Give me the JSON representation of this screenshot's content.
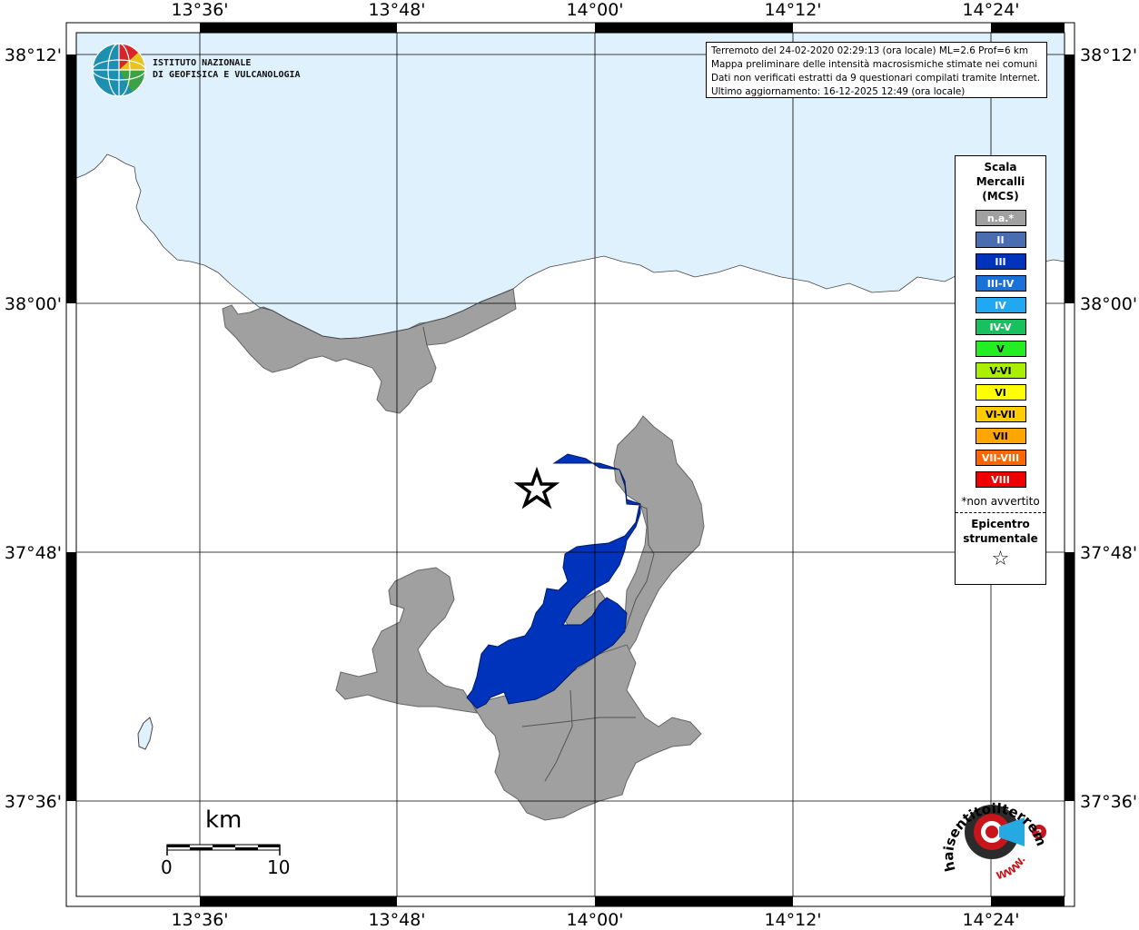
{
  "logo": {
    "name": "ingv-logo-icon",
    "line1": "ISTITUTO NAZIONALE",
    "line2": "DI GEOFISICA E VULCANOLOGIA"
  },
  "info": {
    "line1": "Terremoto del 24-02-2020 02:29:13 (ora locale) ML=2.6 Prof=6 km",
    "line2": "Mappa preliminare delle intensità macrosismiche stimate nei comuni",
    "line3": "Dati non verificati estratti da 9 questionari compilati tramite Internet.",
    "line4": "Ultimo aggiornamento: 16-12-2025 12:49 (ora locale)"
  },
  "axes": {
    "lon_labels": [
      "13°36'",
      "13°48'",
      "14°00'",
      "14°12'",
      "14°24'"
    ],
    "lat_labels": [
      "38°12'",
      "38°00'",
      "37°48'",
      "37°36'"
    ]
  },
  "legend": {
    "title_l1": "Scala",
    "title_l2": "Mercalli",
    "title_l3": "(MCS)",
    "items": [
      {
        "label": "n.a.*",
        "color": "#a0a0a0"
      },
      {
        "label": "II",
        "color": "#4a6db0"
      },
      {
        "label": "III",
        "color": "#0033bb"
      },
      {
        "label": "III-IV",
        "color": "#1a72d8"
      },
      {
        "label": "IV",
        "color": "#22a8f0"
      },
      {
        "label": "IV-V",
        "color": "#18c060"
      },
      {
        "label": "V",
        "color": "#22ee22"
      },
      {
        "label": "V-VI",
        "color": "#aaee00"
      },
      {
        "label": "VI",
        "color": "#ffff00"
      },
      {
        "label": "VI-VII",
        "color": "#ffcc00"
      },
      {
        "label": "VII",
        "color": "#ffa500"
      },
      {
        "label": "VII-VIII",
        "color": "#ff6600"
      },
      {
        "label": "VIII",
        "color": "#ee0000"
      }
    ],
    "note": "*non avvertito",
    "epicentre_l1": "Epicentro",
    "epicentre_l2": "strumentale",
    "star": "☆"
  },
  "scalebar": {
    "unit": "km",
    "min": "0",
    "max": "10"
  },
  "map": {
    "sea_color": "#dff1fd",
    "na_color": "#a0a0a0",
    "intensity_III_color": "#0033bb"
  },
  "badge": {
    "text": "haisentitoilterremoto.it",
    "www": "WWW."
  }
}
